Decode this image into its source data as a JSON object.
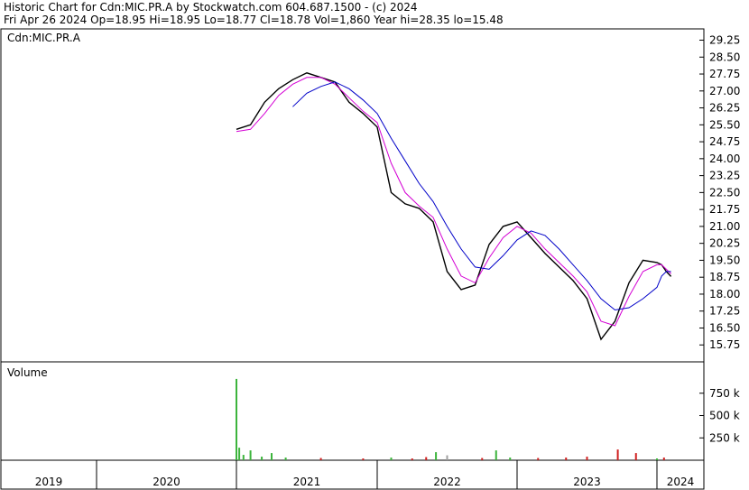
{
  "header": {
    "line1": "Historic Chart for Cdn:MIC.PR.A by Stockwatch.com 604.687.1500 - (c) 2024",
    "line2": "Fri Apr 26 2024   Op=18.95   Hi=18.95   Lo=18.77   Cl=18.78   Vol=1,860   Year hi=28.35   lo=15.48"
  },
  "chart_data": {
    "type": "line",
    "symbol_label": "Cdn:MIC.PR.A",
    "volume_label": "Volume",
    "price_axis": {
      "ylim": [
        15.0,
        29.75
      ],
      "ticks": [
        "29.25",
        "28.50",
        "27.75",
        "27.00",
        "26.25",
        "25.50",
        "24.75",
        "24.00",
        "23.25",
        "22.50",
        "21.75",
        "21.00",
        "20.25",
        "19.50",
        "18.75",
        "18.00",
        "17.25",
        "16.50",
        "15.75"
      ]
    },
    "volume_axis": {
      "ylim": [
        0,
        1000
      ],
      "ticks": [
        "750 k",
        "500 k",
        "250 k"
      ]
    },
    "year_labels": [
      "2019",
      "2020",
      "2021",
      "2022",
      "2023",
      "2024"
    ],
    "price_x": [
      2021.0,
      2021.1,
      2021.2,
      2021.3,
      2021.4,
      2021.5,
      2021.6,
      2021.7,
      2021.8,
      2021.9,
      2022.0,
      2022.1,
      2022.2,
      2022.3,
      2022.4,
      2022.5,
      2022.6,
      2022.7,
      2022.8,
      2022.9,
      2023.0,
      2023.1,
      2023.2,
      2023.3,
      2023.4,
      2023.5,
      2023.6,
      2023.7,
      2023.8,
      2023.9,
      2024.0,
      2024.1,
      2024.2,
      2024.3
    ],
    "series": [
      {
        "values": [
          25.3,
          25.5,
          26.5,
          27.1,
          27.5,
          27.8,
          27.6,
          27.4,
          26.5,
          26.0,
          25.4,
          22.5,
          22.0,
          21.8,
          21.2,
          19.0,
          18.2,
          18.4,
          20.2,
          21.0,
          21.2,
          20.5,
          19.8,
          19.2,
          18.6,
          17.8,
          16.0,
          16.8,
          18.5,
          19.5,
          19.4,
          19.3,
          19.0,
          18.78
        ],
        "color": "#000000"
      },
      {
        "values": [
          25.2,
          25.3,
          26.0,
          26.8,
          27.3,
          27.6,
          27.6,
          27.3,
          26.7,
          26.1,
          25.6,
          23.8,
          22.5,
          21.9,
          21.4,
          20.0,
          18.8,
          18.5,
          19.6,
          20.5,
          21.0,
          20.7,
          20.0,
          19.4,
          18.8,
          18.1,
          16.8,
          16.6,
          17.9,
          19.0,
          19.3,
          19.3,
          19.1,
          18.9
        ],
        "color": "#d400d4"
      },
      {
        "values": [
          null,
          null,
          null,
          null,
          26.3,
          26.9,
          27.2,
          27.4,
          27.1,
          26.6,
          26.0,
          24.9,
          23.9,
          22.9,
          22.1,
          21.0,
          20.0,
          19.2,
          19.1,
          19.7,
          20.4,
          20.8,
          20.6,
          20.0,
          19.3,
          18.6,
          17.8,
          17.3,
          17.4,
          17.8,
          18.3,
          18.8,
          19.0,
          19.0
        ],
        "color": "#0000c8"
      }
    ],
    "volume_x": [
      2021.0,
      2021.02,
      2021.05,
      2021.1,
      2021.18,
      2021.25,
      2021.35,
      2021.6,
      2021.9,
      2022.1,
      2022.25,
      2022.35,
      2022.42,
      2022.5,
      2022.75,
      2022.85,
      2022.95,
      2023.15,
      2023.35,
      2023.5,
      2023.72,
      2023.85,
      2024.0,
      2024.15
    ],
    "volume_values": [
      910,
      140,
      60,
      110,
      40,
      80,
      30,
      25,
      20,
      30,
      20,
      35,
      90,
      55,
      25,
      110,
      30,
      25,
      30,
      40,
      120,
      80,
      20,
      30
    ],
    "volume_colors": [
      "#3cb43c",
      "#3cb43c",
      "#3cb43c",
      "#3cb43c",
      "#3cb43c",
      "#3cb43c",
      "#3cb43c",
      "#d02020",
      "#d02020",
      "#3cb43c",
      "#d02020",
      "#d02020",
      "#3cb43c",
      "#a0a0a0",
      "#d02020",
      "#3cb43c",
      "#3cb43c",
      "#d02020",
      "#d02020",
      "#d02020",
      "#d02020",
      "#d02020",
      "#3cb43c",
      "#d02020"
    ]
  }
}
